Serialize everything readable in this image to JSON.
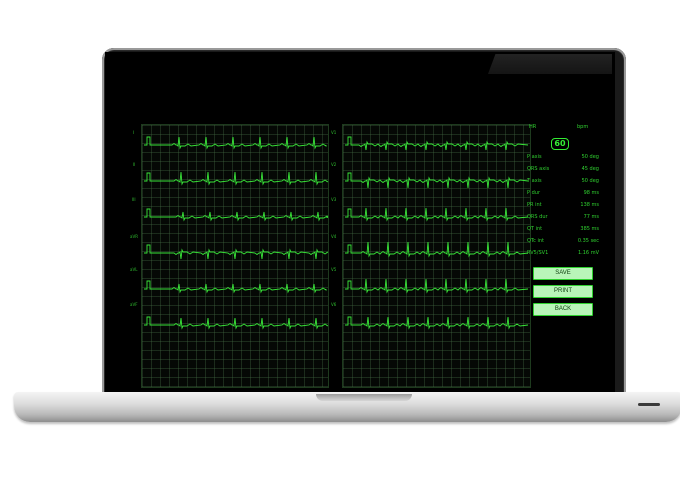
{
  "info": {
    "hr_label": "HR",
    "hr_unit": "bpm",
    "hr_value": "60",
    "measurements": [
      {
        "label": "P axis",
        "value": "50 deg"
      },
      {
        "label": "QRS axis",
        "value": "45 deg"
      },
      {
        "label": "T axis",
        "value": "50 deg"
      },
      {
        "label": "P dur",
        "value": "98 ms"
      },
      {
        "label": "PR int",
        "value": "138 ms"
      },
      {
        "label": "QRS dur",
        "value": "77 ms"
      },
      {
        "label": "QT int",
        "value": "385 ms"
      },
      {
        "label": "QTc int",
        "value": "0.35 sec"
      },
      {
        "label": "RV5/SV1",
        "value": "1.16 mV"
      }
    ]
  },
  "leads_left": [
    "I",
    "II",
    "III",
    "aVR",
    "aVL",
    "aVF"
  ],
  "leads_right": [
    "V1",
    "V2",
    "V3",
    "V4",
    "V5",
    "V6"
  ],
  "buttons": {
    "save": "SAVE",
    "print": "PRINT",
    "back": "BACK"
  },
  "colors": {
    "trace": "#39e639",
    "grid": "#1e3a1e",
    "button_bg": "#b9f5b9",
    "screen": "#000000"
  }
}
